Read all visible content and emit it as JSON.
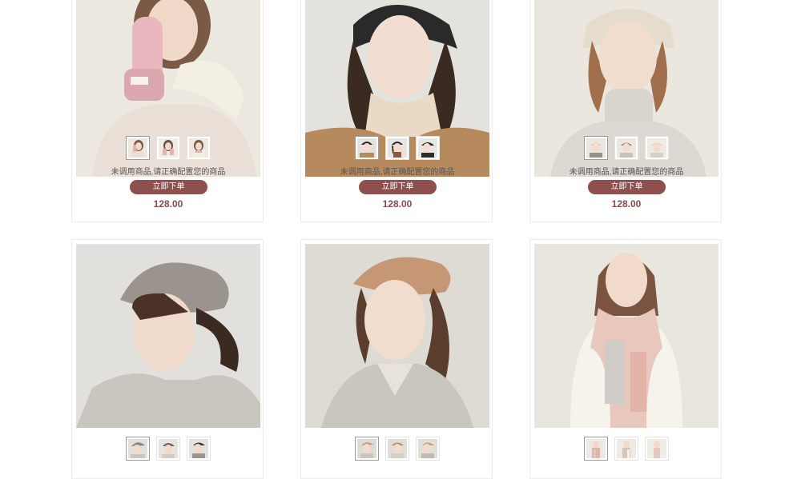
{
  "theme": {
    "accent": "#8e4f4f",
    "price": "#8a4a4a",
    "border": "#ececec"
  },
  "products": [
    {
      "thumbnails": [
        {
          "icon": "glove-model-thumbnail",
          "active": true
        },
        {
          "icon": "glove-model-thumbnail",
          "active": false
        },
        {
          "icon": "glove-model-thumbnail",
          "active": false
        }
      ],
      "note": "未调用商品,请正确配置您的商品",
      "buy_label": "立即下单",
      "price": "128.00"
    },
    {
      "thumbnails": [
        {
          "icon": "beanie-model-thumbnail",
          "active": true
        },
        {
          "icon": "beanie-model-thumbnail",
          "active": false
        },
        {
          "icon": "beanie-model-thumbnail",
          "active": false
        }
      ],
      "note": "未调用商品,请正确配置您的商品",
      "buy_label": "立即下单",
      "price": "128.00"
    },
    {
      "thumbnails": [
        {
          "icon": "bucket-hat-model-thumbnail",
          "active": true
        },
        {
          "icon": "bucket-hat-model-thumbnail",
          "active": false
        },
        {
          "icon": "bucket-hat-model-thumbnail",
          "active": false
        }
      ],
      "note": "未调用商品,请正确配置您的商品",
      "buy_label": "立即下单",
      "price": "128.00"
    },
    {
      "thumbnails": [
        {
          "icon": "beret-model-thumbnail",
          "active": true
        },
        {
          "icon": "beret-model-thumbnail",
          "active": false
        },
        {
          "icon": "beret-model-thumbnail",
          "active": false
        }
      ]
    },
    {
      "thumbnails": [
        {
          "icon": "beret-model-thumbnail",
          "active": true
        },
        {
          "icon": "beret-model-thumbnail",
          "active": false
        },
        {
          "icon": "beret-model-thumbnail",
          "active": false
        }
      ]
    },
    {
      "thumbnails": [
        {
          "icon": "scarf-model-thumbnail",
          "active": true
        },
        {
          "icon": "scarf-model-thumbnail",
          "active": false
        },
        {
          "icon": "scarf-model-thumbnail",
          "active": false
        }
      ]
    }
  ]
}
